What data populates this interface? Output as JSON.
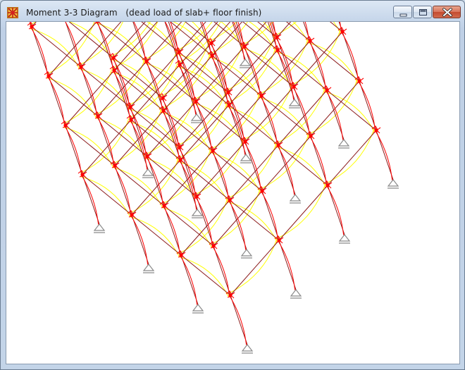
{
  "window": {
    "title": "Moment 3-3 Diagram   (dead load of slab+ floor finish)",
    "icon": "sap2000-app-icon",
    "controls": [
      "minimize-icon",
      "maximize-icon",
      "close-icon"
    ]
  },
  "diagram": {
    "colors": {
      "members": "#8b1a1a",
      "negative_moment": "#ffff00",
      "positive_moment": "#ff0000",
      "supports": "#8a8a8a",
      "background": "#ffffff"
    },
    "levels": 5,
    "bays": 3
  }
}
